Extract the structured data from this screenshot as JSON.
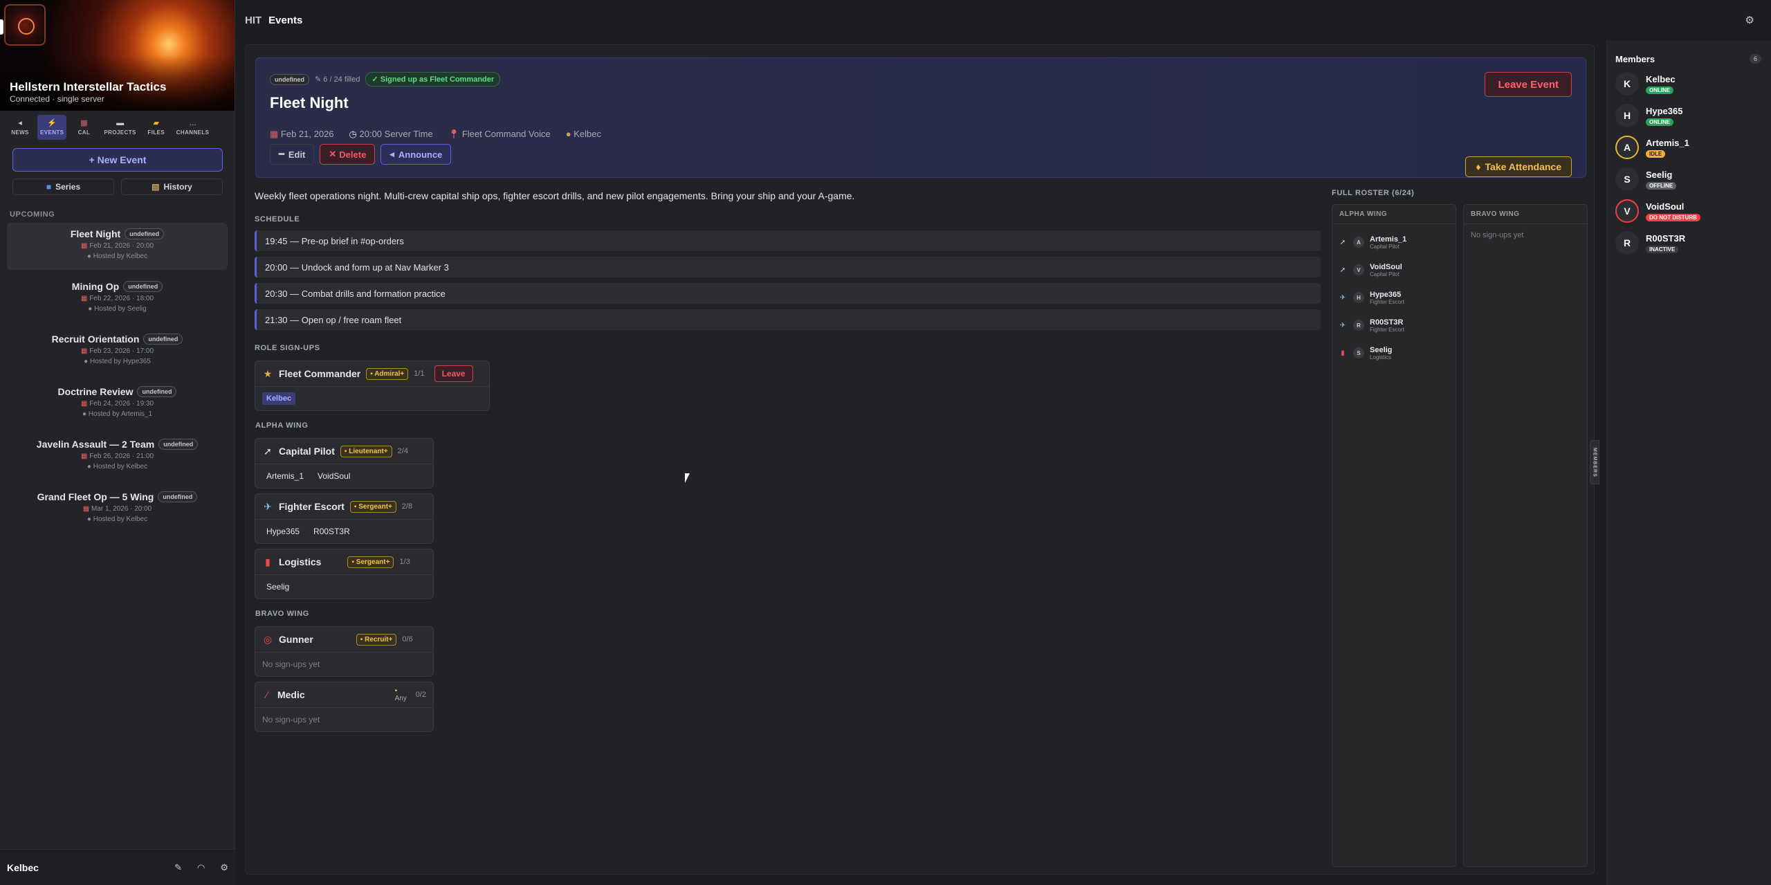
{
  "server": {
    "name": "Hellstern Interstellar Tactics",
    "status": "Connected · single server",
    "short": "HIT"
  },
  "nav": [
    {
      "label": "NEWS",
      "icon": "◂"
    },
    {
      "label": "EVENTS",
      "icon": "⚡"
    },
    {
      "label": "CAL",
      "icon": "▦"
    },
    {
      "label": "PROJECTS",
      "icon": "▬"
    },
    {
      "label": "FILES",
      "icon": "▰"
    },
    {
      "label": "CHANNELS",
      "icon": "…"
    }
  ],
  "sidebar": {
    "new_event": "+ New Event",
    "series": "Series",
    "history": "History",
    "upcoming_label": "UPCOMING",
    "events": [
      {
        "title": "Fleet Night",
        "badge": "undefined",
        "date": "Feb 21, 2026 · 20:00",
        "host": "Hosted by Kelbec"
      },
      {
        "title": "Mining Op",
        "badge": "undefined",
        "date": "Feb 22, 2026 · 18:00",
        "host": "Hosted by Seelig"
      },
      {
        "title": "Recruit Orientation",
        "badge": "undefined",
        "date": "Feb 23, 2026 · 17:00",
        "host": "Hosted by Hype365"
      },
      {
        "title": "Doctrine Review",
        "badge": "undefined",
        "date": "Feb 24, 2026 · 19:30",
        "host": "Hosted by Artemis_1"
      },
      {
        "title": "Javelin Assault — 2 Team",
        "badge": "undefined",
        "date": "Feb 26, 2026 · 21:00",
        "host": "Hosted by Kelbec"
      },
      {
        "title": "Grand Fleet Op — 5 Wing",
        "badge": "undefined",
        "date": "Mar 1, 2026 · 20:00",
        "host": "Hosted by Kelbec"
      }
    ],
    "user": "Kelbec"
  },
  "topbar": {
    "title": "Events"
  },
  "event": {
    "badge": "undefined",
    "filled": "6 / 24 filled",
    "signed": "✓ Signed up as Fleet Commander",
    "title": "Fleet Night",
    "date": "Feb 21, 2026",
    "time": "20:00 Server Time",
    "location": "Fleet Command Voice",
    "host": "Kelbec",
    "edit": "Edit",
    "delete": "Delete",
    "announce": "Announce",
    "leave_event": "Leave Event",
    "take_attendance": "Take Attendance",
    "description": "Weekly fleet operations night. Multi-crew capital ship ops, fighter escort drills, and new pilot engagements. Bring your ship and your A-game."
  },
  "schedule_label": "SCHEDULE",
  "schedule": [
    "19:45 — Pre-op brief in #op-orders",
    "20:00 — Undock and form up at Nav Marker 3",
    "20:30 — Combat drills and formation practice",
    "21:30 — Open op / free roam fleet"
  ],
  "role_signups_label": "ROLE SIGN-UPS",
  "fleet_commander": {
    "name": "Fleet Commander",
    "rank": "Admiral+",
    "count": "1/1",
    "leave": "Leave",
    "member": "Kelbec"
  },
  "alpha_label": "ALPHA WING",
  "alpha_roles": [
    {
      "name": "Capital Pilot",
      "rank": "Lieutenant+",
      "count": "2/4",
      "members": [
        "Artemis_1",
        "VoidSoul"
      ]
    },
    {
      "name": "Fighter Escort",
      "rank": "Sergeant+",
      "count": "2/8",
      "members": [
        "Hype365",
        "R00ST3R"
      ]
    },
    {
      "name": "Logistics",
      "rank": "Sergeant+",
      "count": "1/3",
      "members": [
        "Seelig"
      ]
    }
  ],
  "bravo_label": "BRAVO WING",
  "bravo_roles": [
    {
      "name": "Gunner",
      "rank": "Recruit+",
      "count": "0/6",
      "empty": "No sign-ups yet"
    },
    {
      "name": "Medic",
      "rank": "Any",
      "count": "0/2",
      "empty": "No sign-ups yet"
    }
  ],
  "roster": {
    "label": "FULL ROSTER (6/24)",
    "alpha_title": "ALPHA WING",
    "bravo_title": "BRAVO WING",
    "alpha": [
      {
        "name": "Artemis_1",
        "role": "Capital Pilot",
        "initial": "A"
      },
      {
        "name": "VoidSoul",
        "role": "Capital Pilot",
        "initial": "V"
      },
      {
        "name": "Hype365",
        "role": "Fighter Escort",
        "initial": "H"
      },
      {
        "name": "R00ST3R",
        "role": "Fighter Escort",
        "initial": "R"
      },
      {
        "name": "Seelig",
        "role": "Logistics",
        "initial": "S"
      }
    ],
    "bravo_empty": "No sign-ups yet"
  },
  "members_tab": "MEMBERS",
  "members_panel": {
    "title": "Members",
    "count": "6",
    "list": [
      {
        "name": "Kelbec",
        "initial": "K",
        "status": "ONLINE",
        "color": "#23a55a"
      },
      {
        "name": "Hype365",
        "initial": "H",
        "status": "ONLINE",
        "color": "#23a55a"
      },
      {
        "name": "Artemis_1",
        "initial": "A",
        "status": "IDLE",
        "color": "#f0b232"
      },
      {
        "name": "Seelig",
        "initial": "S",
        "status": "OFFLINE",
        "color": "#5c5e66"
      },
      {
        "name": "VoidSoul",
        "initial": "V",
        "status": "DO NOT DISTURB",
        "color": "#f23f43"
      },
      {
        "name": "R00ST3R",
        "initial": "R",
        "status": "INACTIVE",
        "color": "#3a3b40"
      }
    ]
  }
}
